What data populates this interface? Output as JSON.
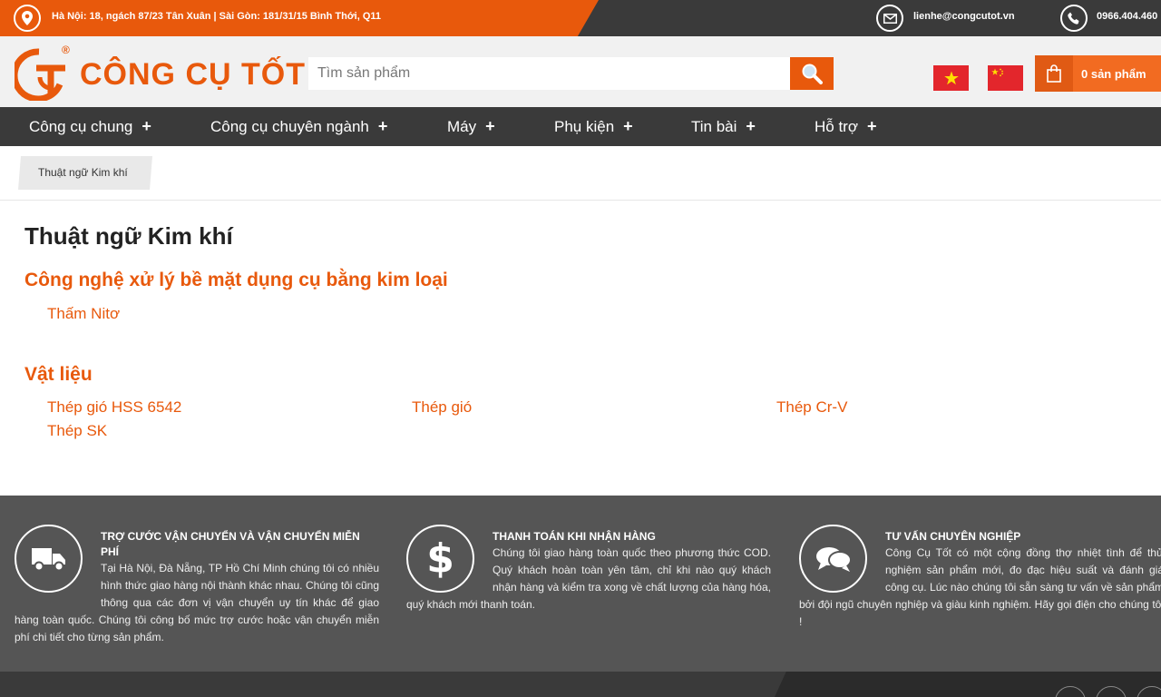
{
  "topbar": {
    "address": "Hà Nội: 18, ngách 87/23 Tân Xuân | Sài Gòn: 181/31/15 Bình Thới, Q11",
    "email": "lienhe@congcutot.vn",
    "phone": "0966.404.460",
    "icons": [
      "map-pin-icon",
      "envelope-icon",
      "phone-icon"
    ]
  },
  "header": {
    "brand_name": "CÔNG CỤ TỐT",
    "logo_mark": "CT",
    "registered": "®",
    "search_placeholder": "Tìm sản phẩm",
    "cart_label": "0 sản phẩm",
    "languages": [
      "vi",
      "zh"
    ]
  },
  "nav": {
    "items": [
      {
        "label": "Công cụ chung",
        "plus": "+"
      },
      {
        "label": "Công cụ chuyên ngành",
        "plus": "+"
      },
      {
        "label": "Máy",
        "plus": "+"
      },
      {
        "label": "Phụ kiện",
        "plus": "+"
      },
      {
        "label": "Tin bài",
        "plus": "+"
      },
      {
        "label": "Hỗ trợ",
        "plus": "+"
      }
    ]
  },
  "breadcrumb": {
    "current": "Thuật ngữ Kim khí"
  },
  "main": {
    "title": "Thuật ngữ Kim khí",
    "sections": [
      {
        "title": "Công nghệ xử lý bề mặt dụng cụ bằng kim loại",
        "terms": [
          "Thấm Nitơ"
        ]
      },
      {
        "title": "Vật liệu",
        "terms": [
          "Thép gió HSS 6542",
          "Thép gió",
          "Thép Cr-V",
          "Thép SK"
        ]
      }
    ]
  },
  "features": [
    {
      "icon": "truck-icon",
      "title": "Trợ cước vận chuyển và vận chuyển miễn phí",
      "description": "Tại Hà Nội, Đà Nẵng, TP Hồ Chí Minh chúng tôi có nhiều hình thức giao hàng nội thành khác nhau. Chúng tôi cũng thông qua các đơn vị vận chuyển uy tín khác để giao hàng toàn quốc. Chúng tôi công bố mức trợ cước hoặc vận chuyển miễn phí chi tiết cho từng sản phẩm."
    },
    {
      "icon": "dollar-icon",
      "title": "Thanh toán khi nhận hàng",
      "description": "Chúng tôi giao hàng toàn quốc theo phương thức COD. Quý khách hoàn toàn yên tâm, chỉ khi nào quý khách nhận hàng và kiểm tra xong về chất lượng của hàng hóa, quý khách mới thanh toán."
    },
    {
      "icon": "chat-bubbles-icon",
      "title": "Tư vấn chuyên nghiệp",
      "description": "Công Cụ Tốt có một cộng đồng thợ nhiệt tình để thử nghiệm sản phẩm mới, đo đạc hiệu suất và đánh giá công cụ. Lúc nào chúng tôi sẵn sàng tư vấn về sản phẩm bởi đội ngũ chuyên nghiệp và giàu kinh nghiệm. Hãy gọi điện cho chúng tôi !"
    }
  ],
  "colors": {
    "accent": "#e8590c",
    "dark": "#3a3a3a",
    "feature_bg": "#555555"
  }
}
